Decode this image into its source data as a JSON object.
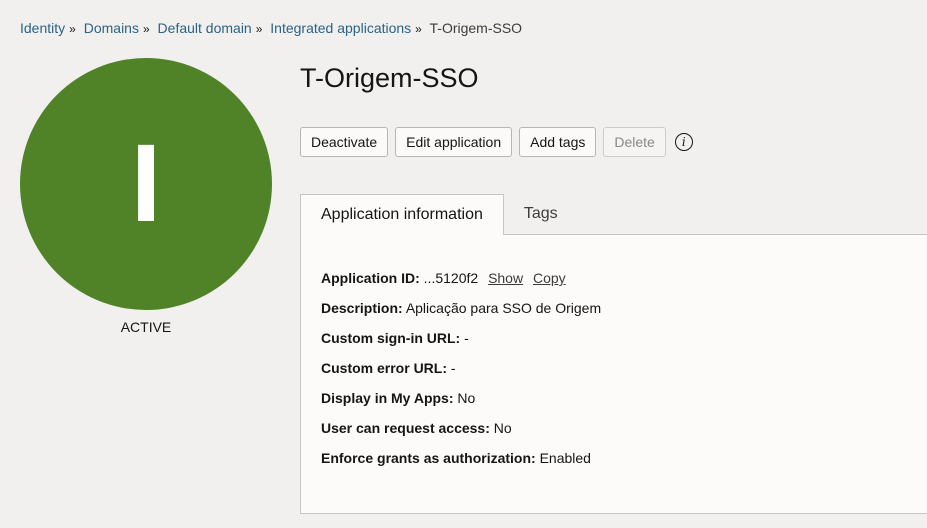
{
  "breadcrumb": {
    "items": [
      "Identity",
      "Domains",
      "Default domain",
      "Integrated applications"
    ],
    "current": "T-Origem-SSO",
    "separator": "»"
  },
  "avatar": {
    "letter": "I",
    "color": "#508327"
  },
  "status": "ACTIVE",
  "title": "T-Origem-SSO",
  "actions": {
    "deactivate": "Deactivate",
    "edit": "Edit application",
    "add_tags": "Add tags",
    "delete": "Delete",
    "info_glyph": "i"
  },
  "tabs": {
    "app_info": "Application information",
    "tags": "Tags"
  },
  "details": {
    "app_id_label": "Application ID:",
    "app_id_value": "...5120f2",
    "show_link": "Show",
    "copy_link": "Copy",
    "description_label": "Description:",
    "description_value": "Aplicação para SSO de Origem",
    "signin_url_label": "Custom sign-in URL:",
    "signin_url_value": "-",
    "error_url_label": "Custom error URL:",
    "error_url_value": "-",
    "display_myapps_label": "Display in My Apps:",
    "display_myapps_value": "No",
    "request_access_label": "User can request access:",
    "request_access_value": "No",
    "enforce_grants_label": "Enforce grants as authorization:",
    "enforce_grants_value": "Enabled"
  }
}
